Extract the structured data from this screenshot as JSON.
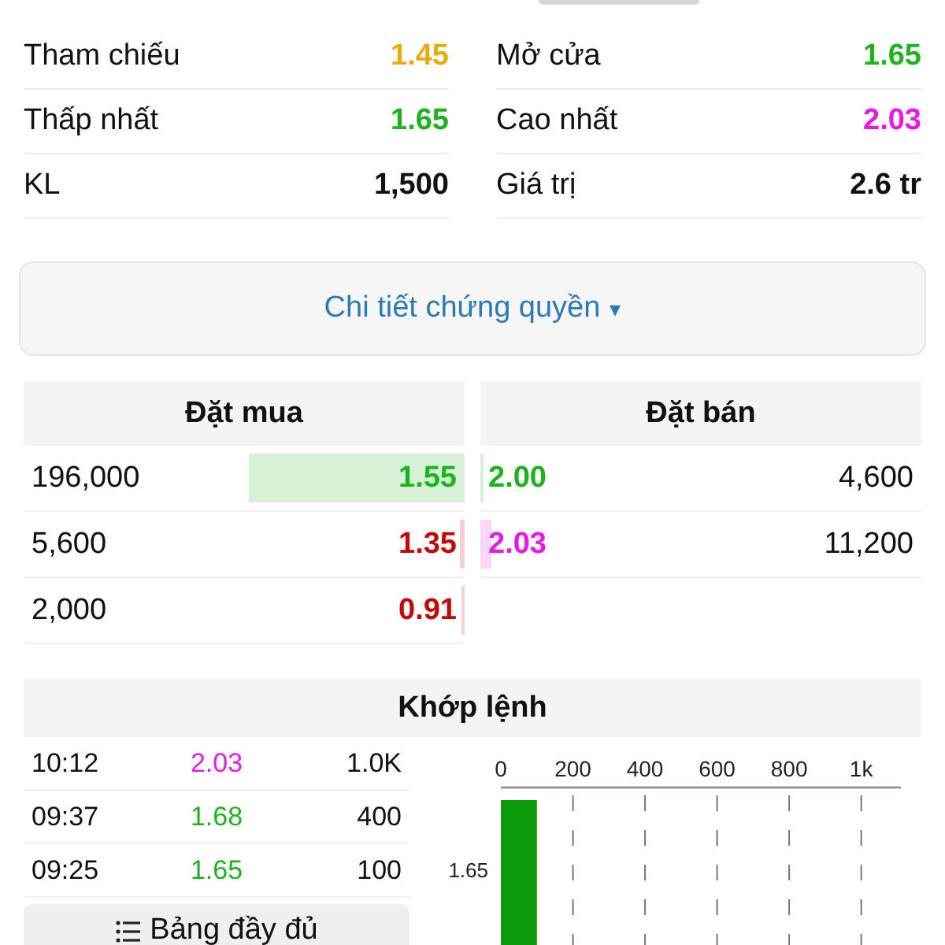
{
  "stats": [
    {
      "label": "Tham chiếu",
      "value": "1.45",
      "color": "#e6ad10"
    },
    {
      "label": "Mở cửa",
      "value": "1.65",
      "color": "#1db31d"
    },
    {
      "label": "Thấp nhất",
      "value": "1.65",
      "color": "#1db31d"
    },
    {
      "label": "Cao nhất",
      "value": "2.03",
      "color": "#e619e6"
    },
    {
      "label": "KL",
      "value": "1,500",
      "color": "#111111"
    },
    {
      "label": "Giá trị",
      "value": "2.6 tr",
      "color": "#111111"
    }
  ],
  "details_button": {
    "label": "Chi tiết chứng quyền",
    "caret": "▾"
  },
  "order_book": {
    "bid_title": "Đặt mua",
    "ask_title": "Đặt bán",
    "bids": [
      {
        "volume": "196,000",
        "price": "1.55",
        "color": "#1db31d",
        "level": 0.49
      },
      {
        "volume": "5,600",
        "price": "1.35",
        "color": "#c40808",
        "level": 0.012
      },
      {
        "volume": "2,000",
        "price": "0.91",
        "color": "#c40808",
        "level": 0.006
      }
    ],
    "asks": [
      {
        "price": "2.00",
        "volume": "4,600",
        "color": "#1db31d",
        "level": 0.006
      },
      {
        "price": "2.03",
        "volume": "11,200",
        "color": "#e619e6",
        "level": 0.025
      }
    ]
  },
  "trades": {
    "title": "Khớp lệnh",
    "rows": [
      {
        "time": "10:12",
        "price": "2.03",
        "volume": "1.0K",
        "color": "#e619e6"
      },
      {
        "time": "09:37",
        "price": "1.68",
        "volume": "400",
        "color": "#1db31d"
      },
      {
        "time": "09:25",
        "price": "1.65",
        "volume": "100",
        "color": "#1db31d"
      }
    ],
    "full_table_button": "Bảng đầy đủ",
    "chart_data": {
      "type": "bar",
      "orientation": "horizontal",
      "categories": [
        "1.65"
      ],
      "values": [
        100
      ],
      "grid": true,
      "xlim": [
        0,
        1110
      ],
      "xticks": [
        0,
        200,
        400,
        600,
        800,
        {
          "value": 1000,
          "label": "1k"
        }
      ]
    }
  }
}
